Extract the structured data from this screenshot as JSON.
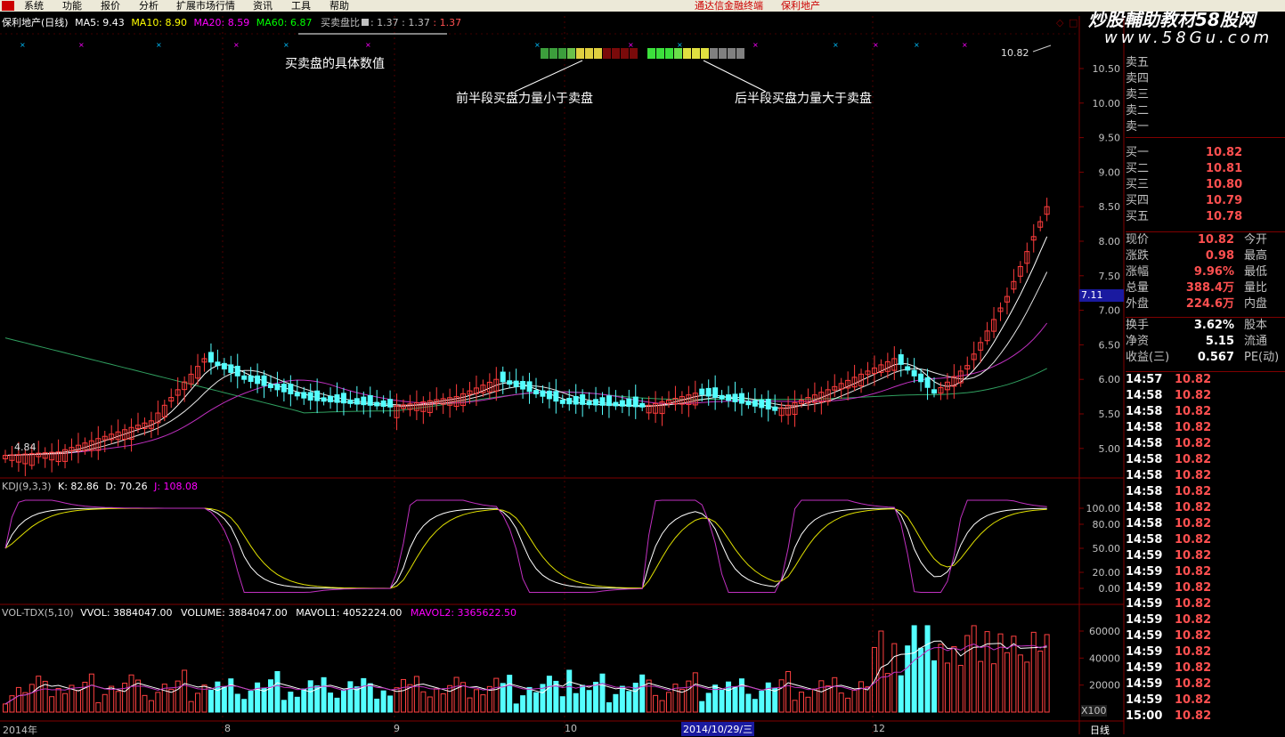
{
  "menu": {
    "items": [
      "系统",
      "功能",
      "报价",
      "分析",
      "扩展市场行情",
      "资讯",
      "工具",
      "帮助"
    ],
    "terminal_title": "通达信金融终端",
    "stock_title": "保利地产"
  },
  "watermark": {
    "brand": "炒股輔助教材58股网",
    "url": "www.58Gu.com"
  },
  "main_chart": {
    "stock_label": "保利地产(日线)",
    "ma5": "MA5: 9.43",
    "ma10": "MA10: 8.90",
    "ma20": "MA20: 8.59",
    "ma60": "MA60: 6.87",
    "ratio_label": "买卖盘比",
    "ratio_v1": ": 1.37",
    "ratio_v2": ": 1.37",
    "ratio_v3": ": 1.37",
    "annotation_values": "买卖盘的具体数值",
    "annotation_first": "前半段买盘力量小于卖盘",
    "annotation_second": "后半段买盘力量大于卖盘",
    "high_label": "10.82",
    "low_label": "4.84",
    "y_ticks": [
      "10.50",
      "10.00",
      "9.50",
      "9.00",
      "8.50",
      "8.00",
      "7.50",
      "7.00",
      "6.50",
      "6.00",
      "5.50",
      "5.00"
    ],
    "current_marker": "7.11",
    "colors": {
      "up": "#ff3c3c",
      "down": "#54ffff",
      "ma5": "#ffffff",
      "ma10": "#ffff00",
      "ma20": "#ff00ff",
      "ma60": "#00ff00"
    }
  },
  "kdj": {
    "label": "KDJ(9,3,3)",
    "k": "K: 82.86",
    "d": "D: 70.26",
    "j": "J: 108.08",
    "y_ticks": [
      "100.00",
      "80.00",
      "50.00",
      "20.00",
      "0.00"
    ]
  },
  "vol": {
    "label": "VOL-TDX(5,10)",
    "vvol": "VVOL: 3884047.00",
    "volume": "VOLUME: 3884047.00",
    "mavol1": "MAVOL1: 4052224.00",
    "mavol2": "MAVOL2: 3365622.50",
    "y_ticks": [
      "60000",
      "40000",
      "20000"
    ],
    "unit": "X100"
  },
  "x_axis": {
    "labels": [
      "2014年",
      "8",
      "9",
      "10",
      "2014/10/29/三",
      "12"
    ]
  },
  "quote": {
    "asks": [
      {
        "label": "卖五"
      },
      {
        "label": "卖四"
      },
      {
        "label": "卖三"
      },
      {
        "label": "卖二"
      },
      {
        "label": "卖一"
      }
    ],
    "bids": [
      {
        "label": "买一",
        "price": "10.82"
      },
      {
        "label": "买二",
        "price": "10.81"
      },
      {
        "label": "买三",
        "price": "10.80"
      },
      {
        "label": "买四",
        "price": "10.79"
      },
      {
        "label": "买五",
        "price": "10.78"
      }
    ],
    "stats": [
      {
        "label": "现价",
        "value": "10.82",
        "label2": "今开"
      },
      {
        "label": "涨跌",
        "value": "0.98",
        "label2": "最高"
      },
      {
        "label": "涨幅",
        "value": "9.96%",
        "label2": "最低"
      },
      {
        "label": "总量",
        "value": "388.4万",
        "label2": "量比"
      },
      {
        "label": "外盘",
        "value": "224.6万",
        "label2": "内盘"
      }
    ],
    "stats2": [
      {
        "label": "换手",
        "value": "3.62%",
        "label2": "股本"
      },
      {
        "label": "净资",
        "value": "5.15",
        "label2": "流通"
      },
      {
        "label": "收益(三)",
        "value": "0.567",
        "label2": "PE(动)"
      }
    ],
    "ticks": [
      {
        "time": "14:57",
        "price": "10.82"
      },
      {
        "time": "14:58",
        "price": "10.82"
      },
      {
        "time": "14:58",
        "price": "10.82"
      },
      {
        "time": "14:58",
        "price": "10.82"
      },
      {
        "time": "14:58",
        "price": "10.82"
      },
      {
        "time": "14:58",
        "price": "10.82"
      },
      {
        "time": "14:58",
        "price": "10.82"
      },
      {
        "time": "14:58",
        "price": "10.82"
      },
      {
        "time": "14:58",
        "price": "10.82"
      },
      {
        "time": "14:58",
        "price": "10.82"
      },
      {
        "time": "14:58",
        "price": "10.82"
      },
      {
        "time": "14:59",
        "price": "10.82"
      },
      {
        "time": "14:59",
        "price": "10.82"
      },
      {
        "time": "14:59",
        "price": "10.82"
      },
      {
        "time": "14:59",
        "price": "10.82"
      },
      {
        "time": "14:59",
        "price": "10.82"
      },
      {
        "time": "14:59",
        "price": "10.82"
      },
      {
        "time": "14:59",
        "price": "10.82"
      },
      {
        "time": "14:59",
        "price": "10.82"
      },
      {
        "time": "14:59",
        "price": "10.82"
      },
      {
        "time": "14:59",
        "price": "10.82"
      },
      {
        "time": "15:00",
        "price": "10.82"
      }
    ],
    "period_tab": "日线"
  }
}
